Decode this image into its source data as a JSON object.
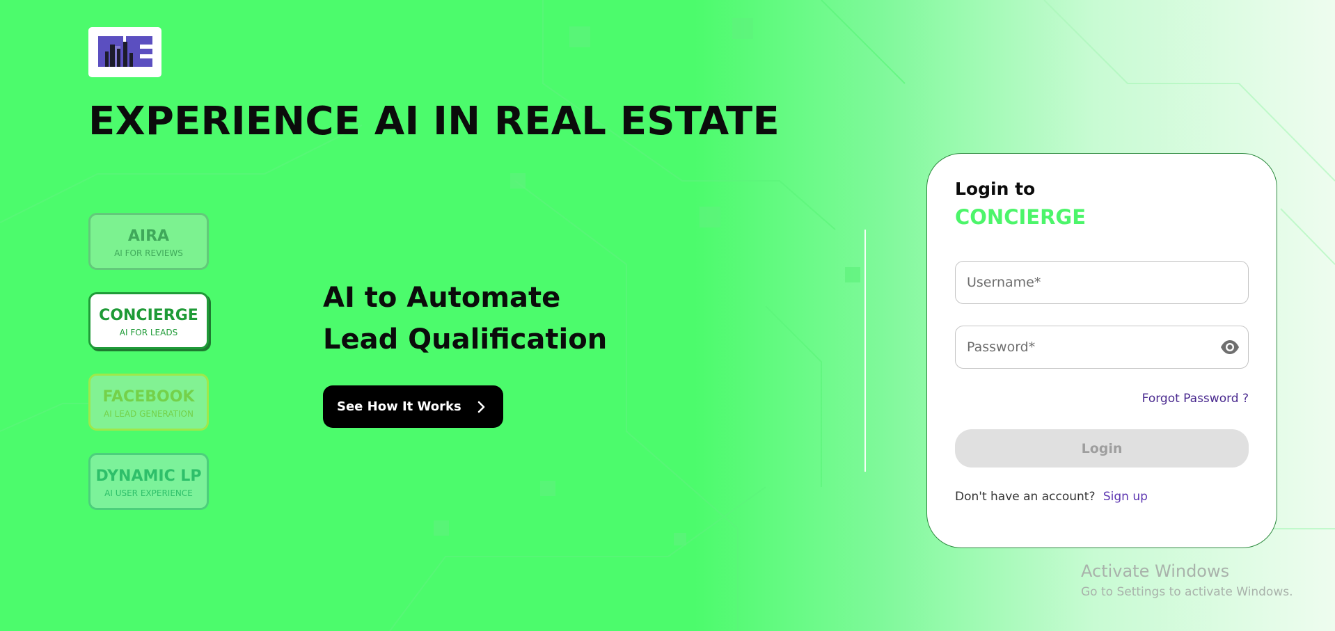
{
  "brand": {
    "logo_text": "RE"
  },
  "hero": {
    "headline": "EXPERIENCE AI IN REAL ESTATE",
    "tagline": "AI to Automate Lead Qualification",
    "cta_label": "See How It Works"
  },
  "products": [
    {
      "name": "AIRA",
      "subtitle": "AI FOR REVIEWS",
      "state": "inactive"
    },
    {
      "name": "CONCIERGE",
      "subtitle": "AI FOR LEADS",
      "state": "active"
    },
    {
      "name": "FACEBOOK",
      "subtitle": "AI LEAD GENERATION",
      "state": "inactive"
    },
    {
      "name": "DYNAMIC LP",
      "subtitle": "AI USER EXPERIENCE",
      "state": "inactive"
    }
  ],
  "login": {
    "title": "Login to",
    "product": "CONCIERGE",
    "username_placeholder": "Username*",
    "username_value": "",
    "password_placeholder": "Password*",
    "password_value": "",
    "forgot_label": "Forgot Password ?",
    "login_label": "Login",
    "signup_prompt": "Don't have an account?",
    "signup_label": "Sign up"
  },
  "watermark": {
    "line1": "Activate Windows",
    "line2": "Go to Settings to activate Windows."
  },
  "icons": {
    "eye": "eye-icon",
    "cta_arrow": "chevron-right-icon"
  },
  "colors": {
    "background": "#4cfb6c",
    "accent_green": "#4cf56a",
    "concierge_green": "#1e9a36",
    "link_purple": "#5b34b0",
    "button_black": "#000000",
    "login_disabled": "#e0e0e0"
  }
}
